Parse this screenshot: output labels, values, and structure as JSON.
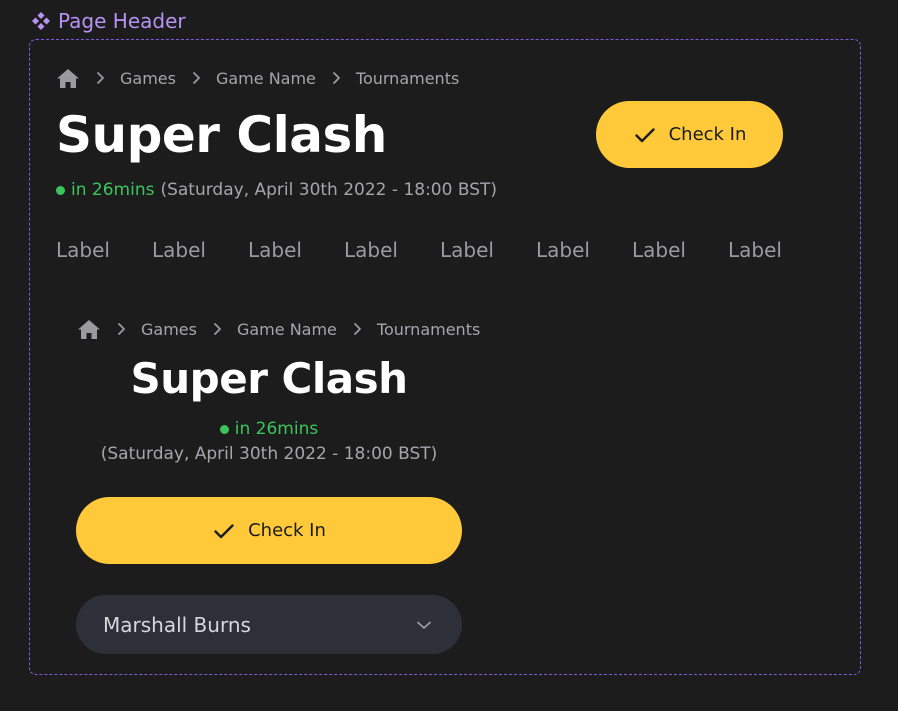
{
  "component_label": "Page Header",
  "breadcrumb": {
    "items": [
      "Games",
      "Game Name",
      "Tournaments"
    ]
  },
  "desktop": {
    "title": "Super Clash",
    "countdown": "in 26mins",
    "datetime": "(Saturday, April 30th 2022 - 18:00 BST)",
    "check_in_label": "Check In",
    "tabs": [
      "Label",
      "Label",
      "Label",
      "Label",
      "Label",
      "Label",
      "Label",
      "Label"
    ]
  },
  "mobile": {
    "title": "Super Clash",
    "countdown": "in 26mins",
    "datetime": "(Saturday, April 30th 2022 - 18:00 BST)",
    "check_in_label": "Check In",
    "dropdown_value": "Marshall Burns"
  },
  "colors": {
    "background": "#1c1c1c",
    "accent": "#ffc93a",
    "status_green": "#3cc45c",
    "frame_border": "#7b5ce0"
  }
}
